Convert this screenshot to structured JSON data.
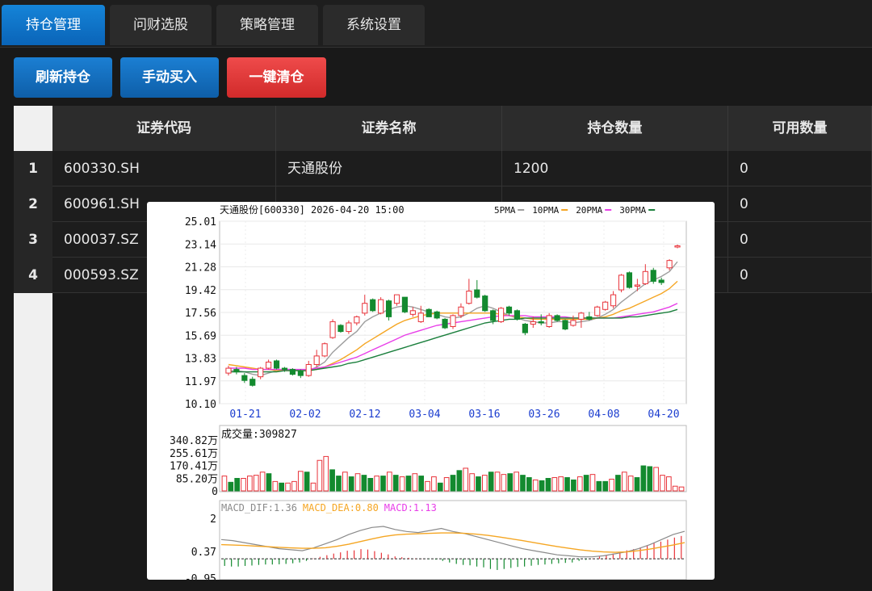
{
  "tabs": [
    {
      "label": "持仓管理",
      "active": true
    },
    {
      "label": "问财选股",
      "active": false
    },
    {
      "label": "策略管理",
      "active": false
    },
    {
      "label": "系统设置",
      "active": false
    }
  ],
  "toolbar": {
    "refresh_label": "刷新持仓",
    "buy_label": "手动买入",
    "clear_label": "一键清仓"
  },
  "table": {
    "columns": [
      "证券代码",
      "证券名称",
      "持仓数量",
      "可用数量"
    ],
    "rows": [
      {
        "num": "1",
        "code": "600330.SH",
        "name": "天通股份",
        "qty": "1200",
        "avail": "0"
      },
      {
        "num": "2",
        "code": "600961.SH",
        "name": "",
        "qty": "",
        "avail": "0"
      },
      {
        "num": "3",
        "code": "000037.SZ",
        "name": "",
        "qty": "",
        "avail": "0"
      },
      {
        "num": "4",
        "code": "000593.SZ",
        "name": "",
        "qty": "",
        "avail": "0"
      }
    ]
  },
  "chart_popup": {
    "header": "天通股份[600330] 2026-04-20 15:00",
    "ma_legend": [
      {
        "label": "5PMA",
        "color": "#9e9e9e"
      },
      {
        "label": "10PMA",
        "color": "#f5a623"
      },
      {
        "label": "20PMA",
        "color": "#e83ee8"
      },
      {
        "label": "30PMA",
        "color": "#1a7f3c"
      }
    ],
    "volume_label": "成交量:309827",
    "macd_legend": [
      {
        "label": "MACD_DIF:1.36",
        "color": "#8a8a8a"
      },
      {
        "label": "MACD_DEA:0.80",
        "color": "#f5a623"
      },
      {
        "label": "MACD:1.13",
        "color": "#e83ee8"
      }
    ]
  },
  "chart_data": [
    {
      "type": "candlestick",
      "title": "天通股份[600330] 2026-04-20 15:00",
      "x_tick_labels": [
        "01-21",
        "02-02",
        "02-12",
        "03-04",
        "03-16",
        "03-26",
        "04-08",
        "04-20"
      ],
      "y_tick_labels": [
        "25.01",
        "23.14",
        "21.28",
        "19.42",
        "17.56",
        "15.69",
        "13.83",
        "11.97",
        "10.10"
      ],
      "ylim": [
        10.1,
        25.01
      ],
      "candles": [
        [
          12.6,
          13.0,
          12.4,
          13.2
        ],
        [
          12.9,
          12.7,
          12.5,
          13.1
        ],
        [
          12.4,
          12.0,
          11.8,
          12.6
        ],
        [
          12.1,
          11.6,
          11.5,
          12.3
        ],
        [
          12.3,
          13.0,
          12.1,
          13.1
        ],
        [
          13.0,
          13.5,
          12.9,
          13.7
        ],
        [
          13.6,
          13.0,
          12.9,
          13.7
        ],
        [
          13.0,
          12.9,
          12.7,
          13.1
        ],
        [
          12.9,
          12.5,
          12.4,
          13.0
        ],
        [
          12.8,
          12.4,
          12.2,
          12.9
        ],
        [
          12.4,
          13.3,
          12.3,
          13.6
        ],
        [
          13.3,
          14.0,
          13.1,
          14.5
        ],
        [
          14.0,
          15.0,
          13.9,
          15.1
        ],
        [
          15.5,
          16.8,
          15.4,
          17.0
        ],
        [
          16.5,
          16.0,
          15.9,
          16.6
        ],
        [
          16.0,
          16.7,
          15.8,
          16.9
        ],
        [
          16.7,
          17.2,
          16.5,
          17.3
        ],
        [
          17.5,
          18.3,
          17.3,
          19.0
        ],
        [
          18.6,
          17.7,
          17.6,
          18.7
        ],
        [
          17.5,
          18.6,
          17.4,
          18.8
        ],
        [
          18.5,
          17.2,
          16.9,
          18.6
        ],
        [
          18.3,
          19.0,
          18.1,
          19.0
        ],
        [
          18.8,
          17.6,
          17.5,
          18.8
        ],
        [
          17.4,
          17.7,
          17.2,
          18.0
        ],
        [
          16.8,
          17.5,
          16.7,
          18.1
        ],
        [
          17.8,
          17.2,
          17.2,
          17.9
        ],
        [
          17.6,
          17.1,
          17.0,
          17.7
        ],
        [
          17.0,
          16.3,
          16.2,
          17.1
        ],
        [
          16.4,
          17.3,
          16.2,
          17.4
        ],
        [
          17.3,
          18.0,
          17.1,
          18.3
        ],
        [
          18.3,
          19.3,
          18.2,
          20.3
        ],
        [
          19.4,
          18.8,
          18.7,
          20.2
        ],
        [
          18.9,
          17.7,
          17.6,
          19.0
        ],
        [
          17.7,
          16.9,
          16.6,
          17.8
        ],
        [
          16.8,
          17.9,
          16.7,
          18.0
        ],
        [
          18.0,
          17.5,
          17.3,
          18.1
        ],
        [
          17.7,
          17.0,
          16.9,
          17.8
        ],
        [
          16.6,
          15.9,
          15.7,
          16.7
        ],
        [
          16.6,
          16.8,
          16.3,
          17.2
        ],
        [
          16.8,
          16.7,
          16.5,
          17.4
        ],
        [
          16.4,
          17.3,
          16.3,
          17.5
        ],
        [
          17.3,
          16.9,
          16.8,
          17.4
        ],
        [
          16.9,
          16.2,
          16.1,
          17.0
        ],
        [
          16.5,
          16.9,
          16.4,
          17.3
        ],
        [
          17.0,
          17.5,
          16.3,
          17.6
        ],
        [
          17.2,
          17.0,
          16.9,
          17.6
        ],
        [
          17.3,
          18.0,
          17.2,
          18.1
        ],
        [
          17.8,
          18.4,
          17.7,
          18.5
        ],
        [
          18.1,
          19.0,
          17.9,
          19.3
        ],
        [
          19.4,
          20.6,
          19.2,
          20.7
        ],
        [
          20.8,
          19.6,
          19.5,
          20.9
        ],
        [
          19.8,
          19.8,
          19.3,
          20.3
        ],
        [
          19.9,
          20.9,
          19.8,
          21.5
        ],
        [
          21.0,
          20.1,
          19.9,
          21.2
        ],
        [
          20.2,
          20.0,
          19.8,
          20.4
        ],
        [
          21.2,
          21.8,
          21.0,
          21.9
        ],
        [
          22.9,
          23.0,
          22.8,
          23.1
        ]
      ],
      "ma_lines": {
        "5PMA": [
          12.8,
          12.8,
          12.7,
          12.5,
          12.4,
          12.6,
          12.8,
          12.9,
          12.9,
          12.8,
          12.8,
          13.1,
          13.5,
          14.3,
          14.9,
          15.5,
          16.0,
          16.8,
          17.2,
          17.5,
          17.8,
          18.0,
          18.1,
          18.0,
          17.8,
          17.6,
          17.4,
          17.2,
          17.1,
          17.2,
          17.5,
          17.9,
          18.1,
          17.9,
          17.6,
          17.3,
          17.1,
          16.9,
          16.8,
          16.7,
          16.7,
          16.8,
          16.8,
          16.7,
          16.8,
          16.9,
          17.1,
          17.4,
          17.8,
          18.4,
          18.9,
          19.4,
          19.9,
          20.2,
          20.5,
          20.9,
          21.7
        ],
        "10PMA": [
          13.3,
          13.2,
          13.1,
          13.0,
          12.9,
          12.9,
          12.8,
          12.8,
          12.8,
          12.8,
          12.8,
          12.9,
          13.1,
          13.4,
          13.7,
          14.1,
          14.5,
          15.0,
          15.4,
          15.8,
          16.2,
          16.6,
          16.9,
          17.1,
          17.3,
          17.4,
          17.5,
          17.5,
          17.5,
          17.5,
          17.5,
          17.5,
          17.5,
          17.5,
          17.4,
          17.3,
          17.2,
          17.1,
          17.0,
          17.0,
          17.0,
          17.0,
          17.0,
          17.0,
          17.0,
          17.0,
          17.1,
          17.2,
          17.4,
          17.7,
          17.9,
          18.2,
          18.5,
          18.8,
          19.1,
          19.5,
          20.1
        ],
        "20PMA": [
          13.0,
          13.0,
          13.0,
          12.9,
          12.9,
          12.9,
          12.9,
          12.9,
          12.9,
          12.9,
          12.9,
          13.0,
          13.1,
          13.3,
          13.5,
          13.7,
          13.9,
          14.2,
          14.5,
          14.8,
          15.1,
          15.4,
          15.7,
          15.9,
          16.1,
          16.3,
          16.5,
          16.6,
          16.7,
          16.8,
          16.9,
          17.0,
          17.1,
          17.2,
          17.3,
          17.3,
          17.3,
          17.3,
          17.2,
          17.2,
          17.2,
          17.2,
          17.2,
          17.1,
          17.1,
          17.1,
          17.1,
          17.1,
          17.1,
          17.2,
          17.3,
          17.4,
          17.5,
          17.6,
          17.8,
          18.0,
          18.3
        ],
        "30PMA": [
          12.7,
          12.7,
          12.7,
          12.7,
          12.7,
          12.7,
          12.7,
          12.8,
          12.8,
          12.8,
          12.8,
          12.9,
          13.0,
          13.1,
          13.2,
          13.4,
          13.5,
          13.7,
          13.9,
          14.1,
          14.3,
          14.5,
          14.7,
          14.9,
          15.1,
          15.3,
          15.5,
          15.7,
          15.9,
          16.1,
          16.3,
          16.5,
          16.7,
          16.8,
          16.9,
          17.0,
          17.0,
          17.1,
          17.1,
          17.1,
          17.1,
          17.1,
          17.1,
          17.1,
          17.1,
          17.1,
          17.1,
          17.1,
          17.1,
          17.1,
          17.2,
          17.2,
          17.3,
          17.4,
          17.5,
          17.6,
          17.8
        ]
      }
    },
    {
      "type": "bar",
      "title": "成交量:309827",
      "y_tick_labels": [
        "340.82万",
        "255.61万",
        "170.41万",
        "85.20万",
        "0"
      ],
      "ylim": [
        0,
        340.82
      ],
      "values": [
        95,
        55,
        80,
        80,
        95,
        100,
        120,
        110,
        60,
        50,
        50,
        60,
        125,
        120,
        50,
        195,
        220,
        135,
        95,
        120,
        90,
        110,
        100,
        80,
        95,
        95,
        120,
        100,
        90,
        95,
        110,
        95,
        60,
        90,
        50,
        85,
        100,
        130,
        145,
        110,
        90,
        100,
        120,
        120,
        105,
        110,
        120,
        100,
        85,
        70,
        65,
        80,
        85,
        90,
        85,
        70,
        90,
        100,
        105,
        60,
        60,
        75,
        100,
        120,
        95,
        85,
        160,
        155,
        150,
        100,
        90,
        30,
        25
      ],
      "colors": [
        "r",
        "g",
        "g",
        "r",
        "r",
        "r",
        "r",
        "g",
        "r",
        "g",
        "r",
        "r",
        "r",
        "g",
        "r",
        "r",
        "r",
        "g",
        "g",
        "r",
        "g",
        "r",
        "g",
        "g",
        "r",
        "g",
        "r",
        "g",
        "r",
        "g",
        "r",
        "g",
        "r",
        "r",
        "g",
        "r",
        "g",
        "g",
        "r",
        "r",
        "g",
        "r",
        "g",
        "r",
        "r",
        "g",
        "r",
        "g",
        "g",
        "r",
        "g",
        "g",
        "r",
        "r",
        "g",
        "g",
        "r",
        "g",
        "r",
        "g",
        "g",
        "r",
        "g",
        "r",
        "r",
        "g",
        "g",
        "g",
        "r",
        "r",
        "r",
        "r",
        "r"
      ]
    },
    {
      "type": "bar",
      "title": "MACD_DIF:1.36  MACD_DEA:0.80  MACD:1.13",
      "y_tick_labels": [
        "2",
        "0.37",
        "-0.95"
      ],
      "ylim": [
        -0.95,
        2
      ],
      "macd": [
        -0.35,
        -0.38,
        -0.38,
        -0.35,
        -0.33,
        -0.3,
        -0.28,
        -0.28,
        -0.27,
        -0.25,
        -0.22,
        -0.18,
        -0.1,
        0.02,
        0.1,
        0.18,
        0.26,
        0.32,
        0.4,
        0.42,
        0.48,
        0.46,
        0.38,
        0.3,
        0.22,
        0.12,
        0.08,
        0.05,
        0.02,
        0.01,
        -0.02,
        -0.04,
        -0.1,
        -0.18,
        -0.25,
        -0.3,
        -0.32,
        -0.38,
        -0.42,
        -0.5,
        -0.55,
        -0.5,
        -0.45,
        -0.4,
        -0.38,
        -0.34,
        -0.3,
        -0.28,
        -0.25,
        -0.22,
        -0.2,
        -0.18,
        -0.1,
        -0.05,
        0.02,
        0.12,
        0.18,
        0.26,
        0.35,
        0.42,
        0.48,
        0.55,
        0.65,
        0.78,
        0.85,
        0.95,
        1.05,
        1.13
      ],
      "dif": [
        0.95,
        0.9,
        0.8,
        0.7,
        0.6,
        0.5,
        0.45,
        0.4,
        0.55,
        0.75,
        0.95,
        1.2,
        1.4,
        1.55,
        1.6,
        1.45,
        1.35,
        1.3,
        1.4,
        1.5,
        1.35,
        1.25,
        1.1,
        0.95,
        0.8,
        0.65,
        0.5,
        0.4,
        0.3,
        0.2,
        0.15,
        0.1,
        0.1,
        0.15,
        0.25,
        0.35,
        0.5,
        0.7,
        0.95,
        1.2,
        1.36
      ],
      "dea": [
        0.7,
        0.68,
        0.66,
        0.63,
        0.6,
        0.57,
        0.54,
        0.52,
        0.52,
        0.55,
        0.62,
        0.72,
        0.85,
        0.98,
        1.1,
        1.18,
        1.22,
        1.24,
        1.26,
        1.28,
        1.28,
        1.26,
        1.22,
        1.16,
        1.08,
        0.99,
        0.9,
        0.8,
        0.7,
        0.61,
        0.52,
        0.44,
        0.38,
        0.34,
        0.32,
        0.34,
        0.4,
        0.48,
        0.58,
        0.68,
        0.8
      ]
    }
  ]
}
